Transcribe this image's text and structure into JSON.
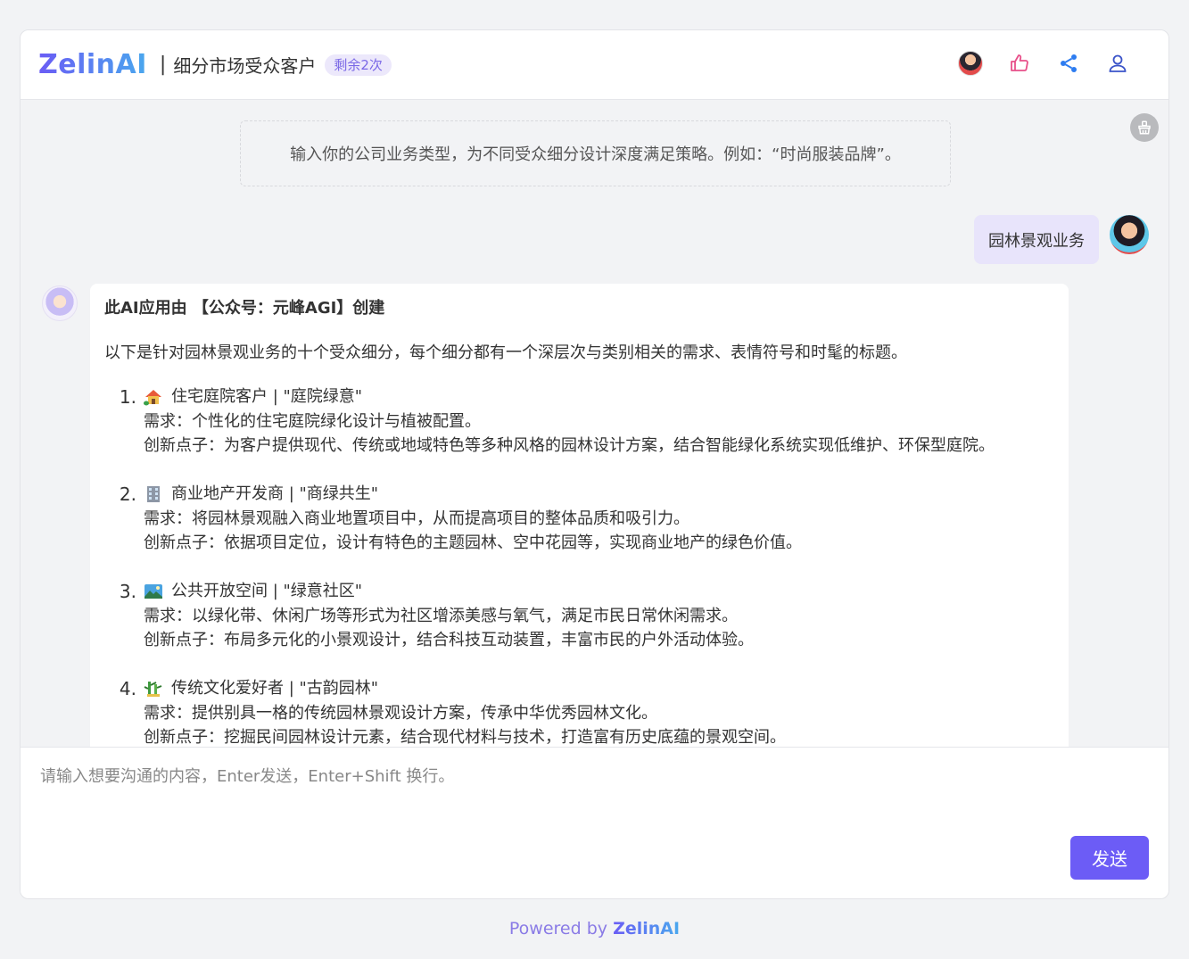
{
  "header": {
    "logo": "ZelinAI",
    "separator": "|",
    "title": "细分市场受众客户",
    "badge": "剩余2次",
    "icons": [
      "avatar",
      "thumb-up-icon",
      "share-icon",
      "user-icon"
    ],
    "icon_colors": {
      "thumb": "#e8508a",
      "share": "#2d7cf0",
      "user": "#3b54c9"
    }
  },
  "chat": {
    "hint": "输入你的公司业务类型，为不同受众细分设计深度满足策略。例如：“时尚服装品牌”。",
    "user_message": "园林景观业务",
    "ai": {
      "heading": "此AI应用由 【公众号：元峰AGI】创建",
      "intro": "以下是针对园林景观业务的十个受众细分，每个细分都有一个深层次与类别相关的需求、表情符号和时髦的标题。",
      "items": [
        {
          "num": "1.",
          "emoji": "house-icon",
          "title": "住宅庭院客户 | \"庭院绿意\"",
          "need": "需求：个性化的住宅庭院绿化设计与植被配置。",
          "idea": "创新点子：为客户提供现代、传统或地域特色等多种风格的园林设计方案，结合智能绿化系统实现低维护、环保型庭院。"
        },
        {
          "num": "2.",
          "emoji": "office-building-icon",
          "title": "商业地产开发商 | \"商绿共生\"",
          "need": "需求：将园林景观融入商业地置项目中，从而提高项目的整体品质和吸引力。",
          "idea": "创新点子：依据项目定位，设计有特色的主题园林、空中花园等，实现商业地产的绿色价值。"
        },
        {
          "num": "3.",
          "emoji": "landscape-icon",
          "title": "公共开放空间 | \"绿意社区\"",
          "need": "需求：以绿化带、休闲广场等形式为社区增添美感与氧气，满足市民日常休闲需求。",
          "idea": "创新点子：布局多元化的小景观设计，结合科技互动装置，丰富市民的户外活动体验。"
        },
        {
          "num": "4.",
          "emoji": "bamboo-icon",
          "title": "传统文化爱好者 | \"古韵园林\"",
          "need": "需求：提供别具一格的传统园林景观设计方案，传承中华优秀园林文化。",
          "idea": "创新点子：挖掘民间园林设计元素，结合现代材料与技术，打造富有历史底蕴的景观空间。"
        }
      ]
    }
  },
  "input": {
    "placeholder": "请输入想要沟通的内容，Enter发送，Enter+Shift 换行。",
    "send_label": "发送"
  },
  "footer": {
    "powered_by": "Powered by ",
    "brand": "ZelinAI"
  },
  "colors": {
    "accent": "#6c5cf6",
    "badge_bg": "#ece8fb",
    "user_bubble": "#e8e4fb"
  }
}
